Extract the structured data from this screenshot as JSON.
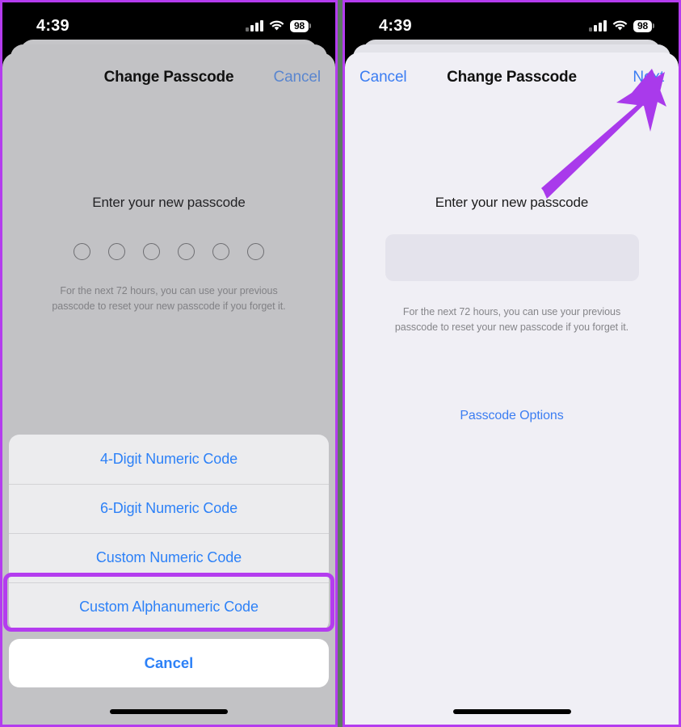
{
  "colors": {
    "annotation_purple": "#b43cef",
    "arrow_purple": "#a93aeb",
    "ios_blue": "#2d81f7",
    "dimmed_background": "#c2c2c5",
    "sheet_background": "#f0eff5"
  },
  "panels": [
    {
      "id": "left",
      "status_bar": {
        "time": "4:39",
        "cellular_icon": "signal-bars-icon",
        "wifi_icon": "wifi-icon",
        "battery_level": "98"
      },
      "navbar": {
        "title": "Change Passcode",
        "right_button": "Cancel"
      },
      "content": {
        "prompt": "Enter your new passcode",
        "dot_count": 6,
        "note": "For the next 72 hours, you can use your previous passcode to reset your new passcode if you forget it."
      },
      "action_sheet": {
        "options": [
          "4-Digit Numeric Code",
          "6-Digit Numeric Code",
          "Custom Numeric Code",
          "Custom Alphanumeric Code"
        ],
        "highlighted_option": "Custom Alphanumeric Code",
        "cancel_label": "Cancel"
      }
    },
    {
      "id": "right",
      "status_bar": {
        "time": "4:39",
        "cellular_icon": "signal-bars-icon",
        "wifi_icon": "wifi-icon",
        "battery_level": "98"
      },
      "navbar": {
        "left_button": "Cancel",
        "title": "Change Passcode",
        "right_button": "Next"
      },
      "content": {
        "prompt": "Enter your new passcode",
        "field_value": "",
        "note": "For the next 72 hours, you can use your previous passcode to reset your new passcode if you forget it.",
        "passcode_options_link": "Passcode Options"
      },
      "annotation": {
        "arrow_target": "Next",
        "arrow_icon": "arrow-pointer-icon"
      }
    }
  ]
}
